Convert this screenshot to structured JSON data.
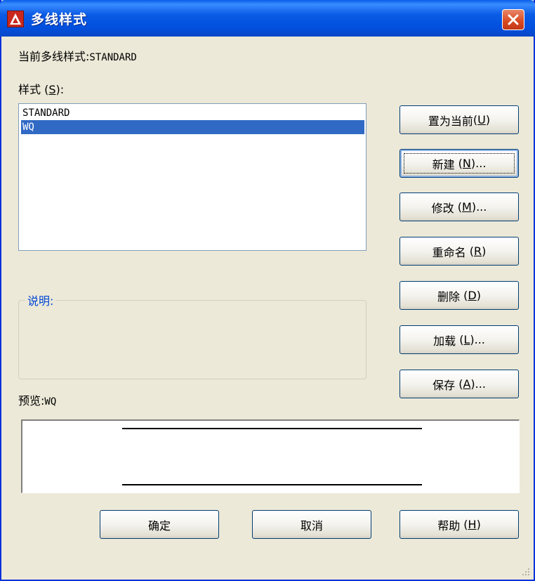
{
  "window": {
    "title": "多线样式",
    "close_label": "×"
  },
  "current_style": {
    "label": "当前多线样式:",
    "value": "STANDARD"
  },
  "styles_label": {
    "text": "样式",
    "open": " (",
    "key": "S",
    "close": "):"
  },
  "styles_list": [
    {
      "name": "STANDARD",
      "selected": false
    },
    {
      "name": "WQ",
      "selected": true
    }
  ],
  "description": {
    "legend": "说明:",
    "text": ""
  },
  "preview": {
    "label": "预览:",
    "value": "WQ"
  },
  "buttons": {
    "set_current": {
      "text": "置为当前",
      "key": "U",
      "suffix": ""
    },
    "new": {
      "text": "新建",
      "key": "N",
      "suffix": "..."
    },
    "modify": {
      "text": "修改",
      "key": "M",
      "suffix": "..."
    },
    "rename": {
      "text": "重命名",
      "key": "R",
      "suffix": ""
    },
    "delete": {
      "text": "删除",
      "key": "D",
      "suffix": ""
    },
    "load": {
      "text": "加载",
      "key": "L",
      "suffix": "..."
    },
    "save": {
      "text": "保存",
      "key": "A",
      "suffix": "..."
    },
    "ok": {
      "text": "确定"
    },
    "cancel": {
      "text": "取消"
    },
    "help": {
      "text": "帮助",
      "key": "H",
      "suffix": ""
    }
  },
  "colors": {
    "titlebar": "#0A5BE6",
    "selection": "#316AC5",
    "legend": "#0046D5",
    "close": "#D8491F"
  }
}
